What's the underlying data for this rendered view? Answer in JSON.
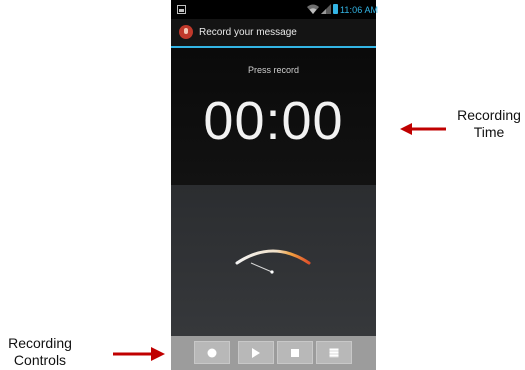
{
  "status_bar": {
    "time": "11:06 AM",
    "icons": [
      "gallery-icon",
      "wifi-icon",
      "signal-icon",
      "battery-icon"
    ],
    "accent_color": "#33b5e5"
  },
  "action_bar": {
    "icon": "microphone-icon",
    "title": "Record your message"
  },
  "recorder": {
    "status": "Press record",
    "timer": "00:00",
    "meter_level": 0
  },
  "controls": {
    "buttons": [
      "record-icon",
      "play-icon",
      "stop-icon",
      "list-icon"
    ]
  },
  "annotations": {
    "time_label_line1": "Recording",
    "time_label_line2": "Time",
    "controls_label_line1": "Recording",
    "controls_label_line2": "Controls",
    "arrow_color": "#c00000"
  }
}
